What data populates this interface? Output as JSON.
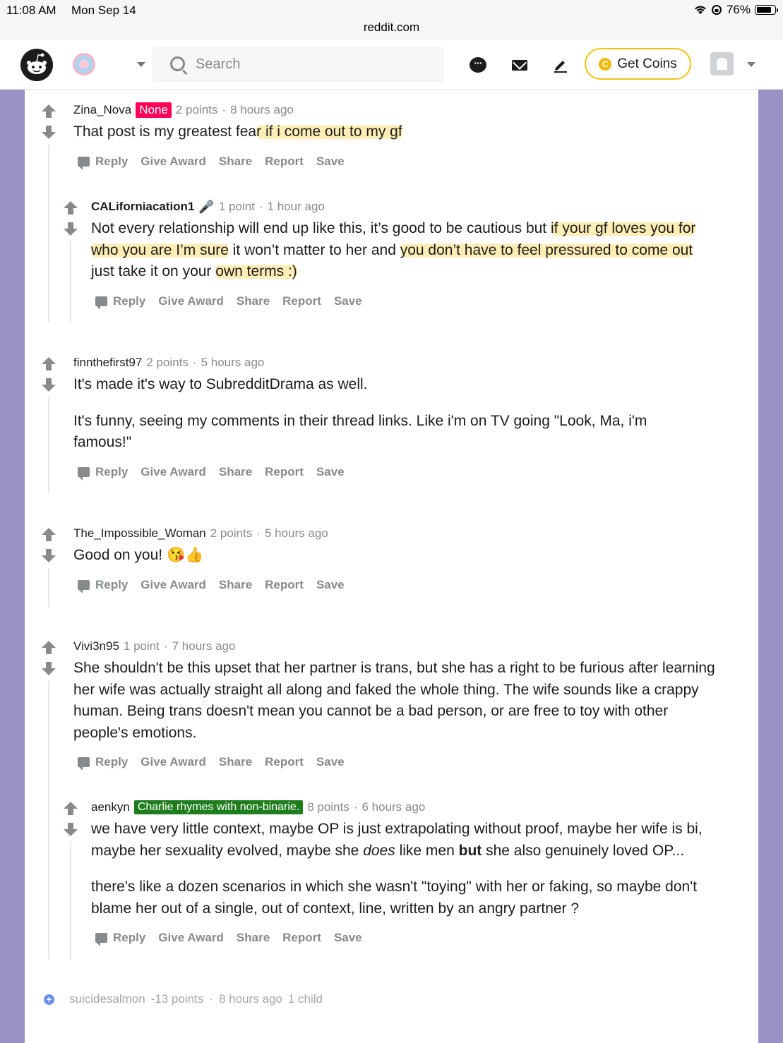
{
  "status_bar": {
    "time": "11:08 AM",
    "date": "Mon Sep 14",
    "url": "reddit.com",
    "battery": "76%",
    "battery_level": 0.76
  },
  "header": {
    "search_placeholder": "Search",
    "get_coins_label": "Get Coins",
    "coin_glyph": "C",
    "icons": [
      "reddit-logo",
      "community-icon",
      "chat-icon",
      "mail-icon",
      "create-post-icon",
      "coin-icon",
      "avatar"
    ]
  },
  "colors": {
    "side_margin": "#9a91c5",
    "none_flair": "#ff0058",
    "green_flair": "#1e7e1e",
    "highlight": "#fde078",
    "coins_border": "#f0c419"
  },
  "actions": {
    "reply": "Reply",
    "give_award": "Give Award",
    "share": "Share",
    "report": "Report",
    "save": "Save"
  },
  "comments": [
    {
      "author": "Zina_Nova",
      "flair": "None",
      "points": "2 points",
      "sep": "·",
      "time": "8 hours ago",
      "text_a": "That post is my greatest fea",
      "text_hl": "r if i come out to my gf"
    },
    {
      "author": "CALiforniacation1",
      "points": "1 point",
      "sep": "·",
      "time": "1 hour ago",
      "l1_a": "Not every relationship will end up like this, it’s good to be cautious but ",
      "l1_hl": "if your gf loves you for",
      "l2_hl1": "who you are I’m sure",
      "l2_b": " it won’t matter to her and ",
      "l2_hl2": "you don’t have to feel pressured to come out",
      "l3_a": "just take it on your ",
      "l3_hl": "own terms :)"
    },
    {
      "author": "finnthefirst97",
      "points": "2 points",
      "sep": "·",
      "time": "5 hours ago",
      "p1": "It's made it's way to SubredditDrama as well.",
      "p2": "It's funny, seeing my comments in their thread links. Like i'm on TV going \"Look, Ma, i'm famous!\""
    },
    {
      "author": "The_Impossible_Woman",
      "points": "2 points",
      "sep": "·",
      "time": "5 hours ago",
      "text": "Good on you! ",
      "emoji": "😘👍"
    },
    {
      "author": "Vivi3n95",
      "points": "1 point",
      "sep": "·",
      "time": "7 hours ago",
      "text": "She shouldn't be this upset that her partner is trans, but she has a right to be furious after learning her wife was actually straight all along and faked the whole thing. The wife sounds like a crappy human. Being trans doesn't mean you cannot be a bad person, or are free to toy with other people's emotions."
    },
    {
      "author": "aenkyn",
      "flair": "Charlie rhymes with non-binarie.",
      "points": "8 points",
      "sep": "·",
      "time": "6 hours ago",
      "p1_a": "we have very little context, maybe OP is just extrapolating without proof, maybe her wife is bi, maybe her sexuality evolved, maybe she ",
      "p1_em": "does",
      "p1_b": " like men ",
      "p1_strong": "but",
      "p1_c": " she also genuinely loved OP...",
      "p2": "there's like a dozen scenarios in which she wasn't \"toying\" with her or faking, so maybe don't blame her out of a single, out of context, line, written by an angry partner ?"
    }
  ],
  "collapsed_comment": {
    "author": "suicidesalmon",
    "points": "-13 points",
    "sep": "·",
    "time": "8 hours ago",
    "children": "1 child",
    "expand_glyph": "+"
  }
}
